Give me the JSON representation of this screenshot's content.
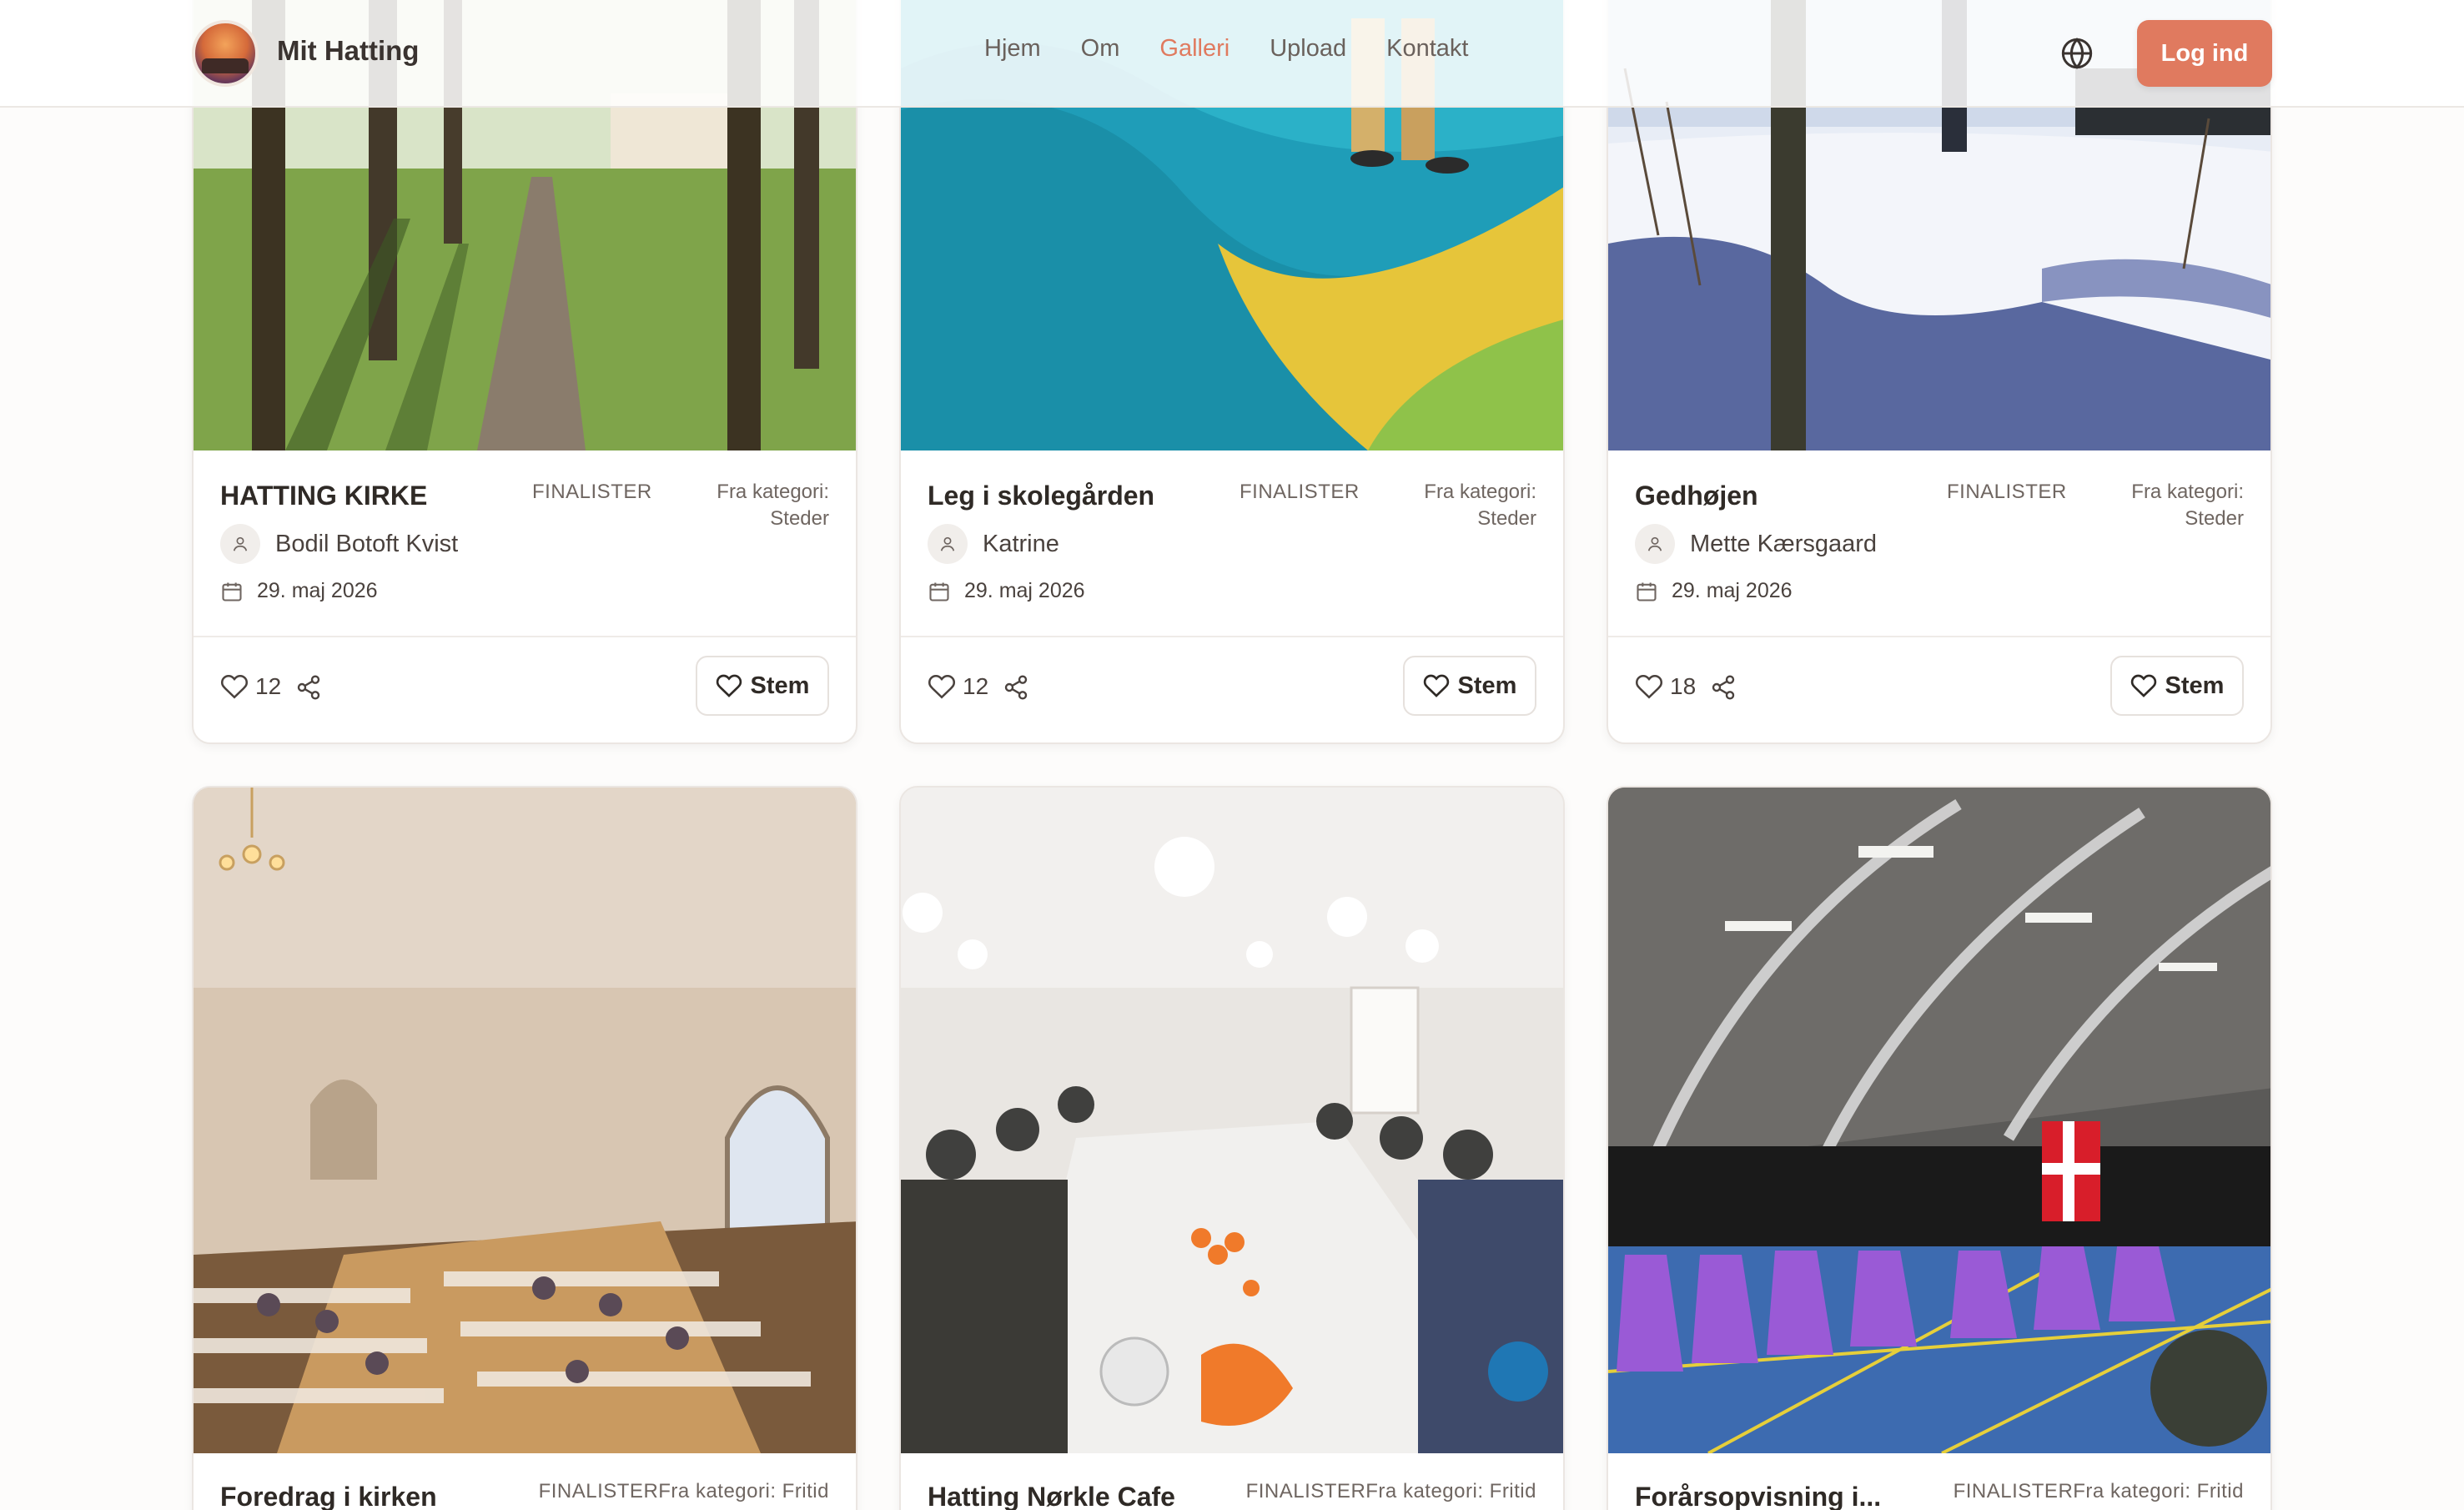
{
  "header": {
    "brand": "Mit Hatting",
    "nav": [
      {
        "label": "Hjem",
        "active": false
      },
      {
        "label": "Om",
        "active": false
      },
      {
        "label": "Galleri",
        "active": true
      },
      {
        "label": "Upload",
        "active": false
      },
      {
        "label": "Kontakt",
        "active": false
      }
    ],
    "login_label": "Log ind",
    "accent_color": "#e07a5f"
  },
  "cards": [
    {
      "title": "HATTING KIRKE",
      "badge": "FINALISTER",
      "category_line1": "Fra kategori:",
      "category_line2": "Steder",
      "author": "Bodil Botoft Kvist",
      "date": "29. maj 2026",
      "likes": "12",
      "vote_label": "Stem"
    },
    {
      "title": "Leg i skolegården",
      "badge": "FINALISTER",
      "category_line1": "Fra kategori:",
      "category_line2": "Steder",
      "author": "Katrine",
      "date": "29. maj 2026",
      "likes": "12",
      "vote_label": "Stem"
    },
    {
      "title": "Gedhøjen",
      "badge": "FINALISTER",
      "category_line1": "Fra kategori:",
      "category_line2": "Steder",
      "author": "Mette Kærsgaard",
      "date": "29. maj 2026",
      "likes": "18",
      "vote_label": "Stem"
    },
    {
      "title": "Foredrag i kirken",
      "badge_category": "FINALISTERFra kategori: Fritid"
    },
    {
      "title": "Hatting Nørkle Cafe",
      "badge_category": "FINALISTERFra kategori: Fritid"
    },
    {
      "title": "Forårsopvisning i...",
      "badge_category": "FINALISTERFra kategori: Fritid"
    }
  ]
}
